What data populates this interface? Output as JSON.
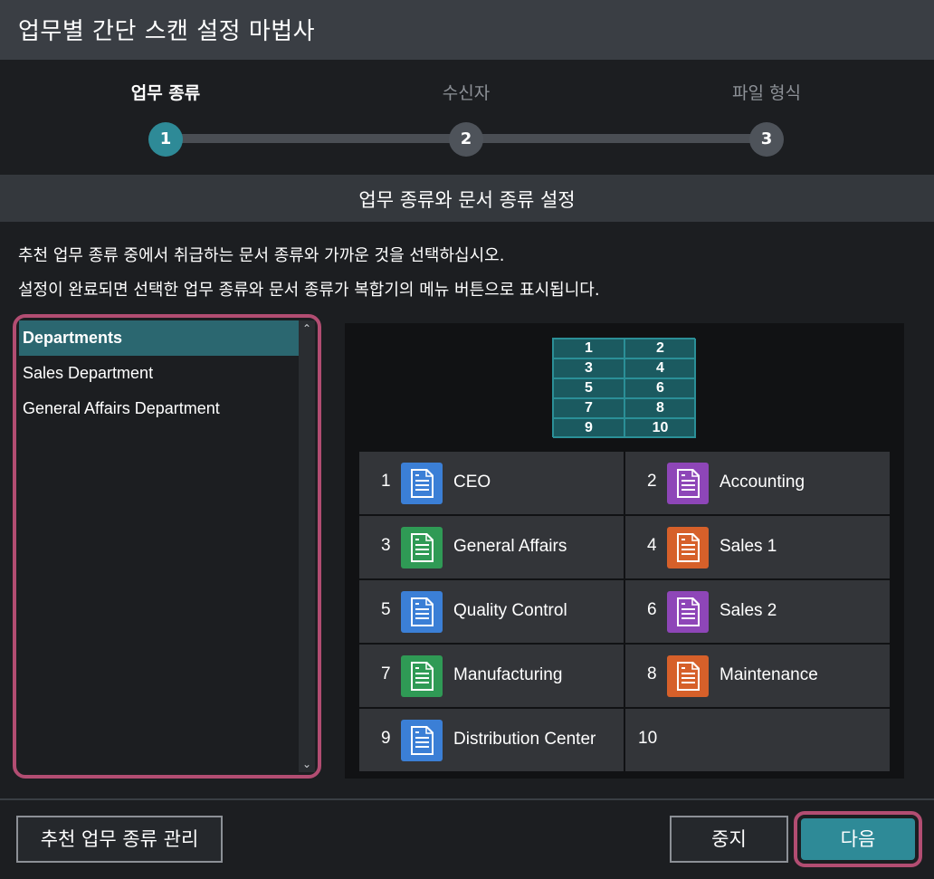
{
  "window": {
    "title": "업무별 간단 스캔 설정 마법사"
  },
  "steps": [
    {
      "label": "업무 종류",
      "number": "1",
      "state": "active"
    },
    {
      "label": "수신자",
      "number": "2",
      "state": "inactive"
    },
    {
      "label": "파일 형식",
      "number": "3",
      "state": "inactive"
    }
  ],
  "section": {
    "title": "업무 종류와 문서 종류 설정"
  },
  "description": {
    "line1": "추천 업무 종류 중에서 취급하는 문서 종류와 가까운 것을 선택하십시오.",
    "line2": "설정이 완료되면 선택한 업무 종류와 문서 종류가 복합기의 메뉴 버튼으로 표시됩니다."
  },
  "list": {
    "items": [
      {
        "label": "Departments",
        "selected": true
      },
      {
        "label": "Sales Department",
        "selected": false
      },
      {
        "label": "General Affairs Department",
        "selected": false
      }
    ]
  },
  "grid_map": [
    "1",
    "2",
    "3",
    "4",
    "5",
    "6",
    "7",
    "8",
    "9",
    "10"
  ],
  "buttons": [
    {
      "num": "1",
      "label": "CEO",
      "icon": "document-icon",
      "color": "#3b7fd6"
    },
    {
      "num": "2",
      "label": "Accounting",
      "icon": "document-icon",
      "color": "#8e46b8"
    },
    {
      "num": "3",
      "label": "General Affairs",
      "icon": "document-icon",
      "color": "#2f9a55"
    },
    {
      "num": "4",
      "label": "Sales 1",
      "icon": "document-icon",
      "color": "#d6602a"
    },
    {
      "num": "5",
      "label": "Quality Control",
      "icon": "document-icon",
      "color": "#3b7fd6"
    },
    {
      "num": "6",
      "label": "Sales 2",
      "icon": "document-icon",
      "color": "#8e46b8"
    },
    {
      "num": "7",
      "label": "Manufacturing",
      "icon": "document-icon",
      "color": "#2f9a55"
    },
    {
      "num": "8",
      "label": "Maintenance",
      "icon": "document-icon",
      "color": "#d6602a"
    },
    {
      "num": "9",
      "label": "Distribution Center",
      "icon": "document-icon",
      "color": "#3b7fd6"
    },
    {
      "num": "10",
      "label": "",
      "icon": "",
      "color": ""
    }
  ],
  "footer": {
    "manage_label": "추천 업무 종류 관리",
    "cancel_label": "중지",
    "next_label": "다음"
  },
  "colors": {
    "accent": "#2e8a97",
    "highlight": "#b24d72"
  }
}
